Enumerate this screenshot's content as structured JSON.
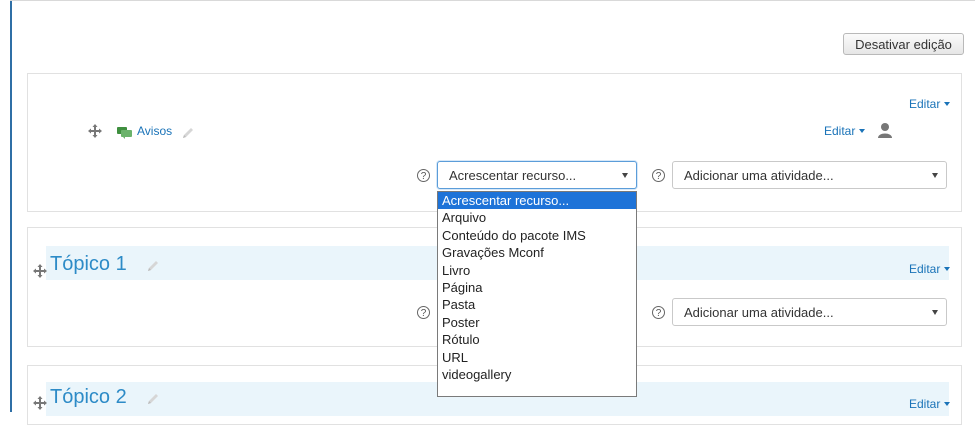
{
  "toolbar": {
    "toggle_edit_label": "Desativar edição"
  },
  "section0": {
    "edit_label": "Editar",
    "activity": {
      "name": "Avisos",
      "edit_label": "Editar"
    },
    "resource_select": {
      "value": "Acrescentar recurso..."
    },
    "activity_select": {
      "value": "Adicionar uma atividade..."
    }
  },
  "resource_dropdown": {
    "options": [
      "Acrescentar recurso...",
      "Arquivo",
      "Conteúdo do pacote IMS",
      "Gravações Mconf",
      "Livro",
      "Página",
      "Pasta",
      "Poster",
      "Rótulo",
      "URL",
      "videogallery"
    ],
    "selected_index": 0
  },
  "topics": [
    {
      "title": "Tópico 1",
      "edit_label": "Editar",
      "activity_select": {
        "value": "Adicionar uma atividade..."
      }
    },
    {
      "title": "Tópico 2",
      "edit_label": "Editar"
    }
  ],
  "colors": {
    "link": "#1a73b8",
    "topic_title": "#2d8bc7",
    "topic_band": "#eaf5fb",
    "selected_option": "#1e73d8"
  }
}
